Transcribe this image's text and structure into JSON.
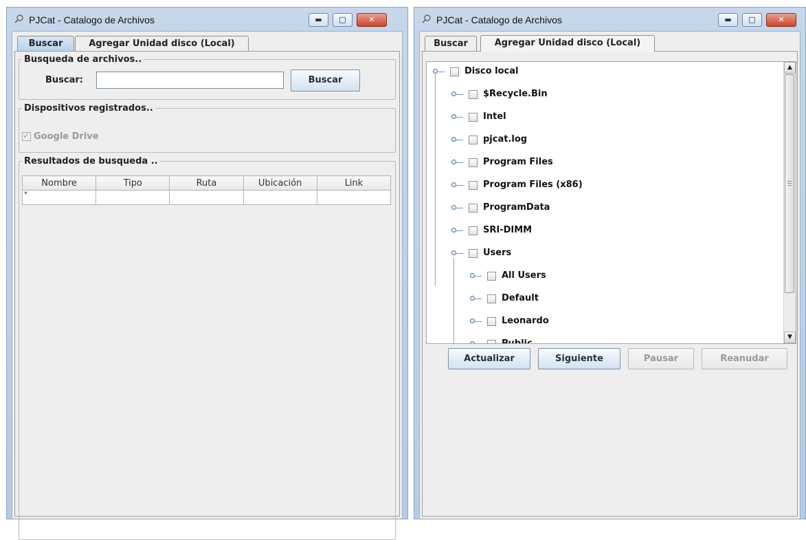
{
  "left_window": {
    "title": "PJCat - Catalogo de Archivos",
    "tabs": [
      {
        "label": "Buscar"
      },
      {
        "label": "Agregar Unidad disco (Local)"
      }
    ],
    "search_section": {
      "legend": "Busqueda de archivos..",
      "field_label": "Buscar:",
      "field_value": "",
      "button_label": "Buscar"
    },
    "devices_section": {
      "legend": "Dispositivos registrados..",
      "devices": [
        {
          "label": "Google Drive",
          "checked": true,
          "enabled": false
        }
      ]
    },
    "results_section": {
      "legend": "Resultados de busqueda ..",
      "columns": [
        "Nombre",
        "Tipo",
        "Ruta",
        "Ubicación",
        "Link"
      ],
      "new_row_marker": "*"
    }
  },
  "right_window": {
    "title": "PJCat - Catalogo de Archivos",
    "tabs": [
      {
        "label": "Buscar"
      },
      {
        "label": "Agregar Unidad disco (Local)"
      }
    ],
    "tree": {
      "root": "Disco local",
      "children": [
        "$Recycle.Bin",
        "Intel",
        "pjcat.log",
        "Program Files",
        "Program Files (x86)",
        "ProgramData",
        "SRI-DIMM",
        "Users"
      ],
      "users_children": [
        "All Users",
        "Default",
        "Leonardo",
        "Public"
      ]
    },
    "buttons": {
      "refresh": "Actualizar",
      "next": "Siguiente",
      "pause": "Pausar",
      "resume": "Reanudar"
    }
  },
  "colors": {
    "frame": "#b7cbe3",
    "panel": "#eeeeee",
    "close_button": "#c8452b",
    "tree_handle": "#4b6f98"
  },
  "icons": {
    "app": "magnifier-icon",
    "minimize": "minimize-icon",
    "maximize": "maximize-icon",
    "close": "close-icon"
  }
}
